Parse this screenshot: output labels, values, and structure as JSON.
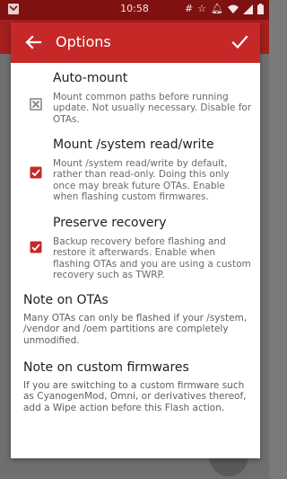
{
  "status_bar": {
    "time": "10:58",
    "icons": [
      "hash-icon",
      "star-icon",
      "bell-icon",
      "wifi-icon",
      "signal-icon",
      "battery-icon"
    ]
  },
  "dialog": {
    "title": "Options",
    "back_icon": "arrow-left-icon",
    "confirm_icon": "check-icon"
  },
  "options": [
    {
      "title": "Auto-mount",
      "description": "Mount common paths before running update. Not usually necessary. Disable for OTAs.",
      "state": "indeterminate"
    },
    {
      "title": "Mount /system read/write",
      "description": "Mount /system read/write by default, rather than read-only. Doing this only once may break future OTAs. Enable when flashing custom firmwares.",
      "state": "checked"
    },
    {
      "title": "Preserve recovery",
      "description": "Backup recovery before flashing and restore it afterwards. Enable when flashing OTAs and you are using a custom recovery such as TWRP.",
      "state": "checked"
    }
  ],
  "notes": [
    {
      "title": "Note on OTAs",
      "text": "Many OTAs can only be flashed if your /system, /vendor and /oem partitions are completely unmodified."
    },
    {
      "title": "Note on custom firmwares",
      "text": "If you are switching to a custom firmware such as CyanogenMod, Omni, or derivatives thereof, add a Wipe action before this Flash action."
    }
  ],
  "colors": {
    "accent": "#c62828",
    "status_bar": "#7f1111"
  }
}
